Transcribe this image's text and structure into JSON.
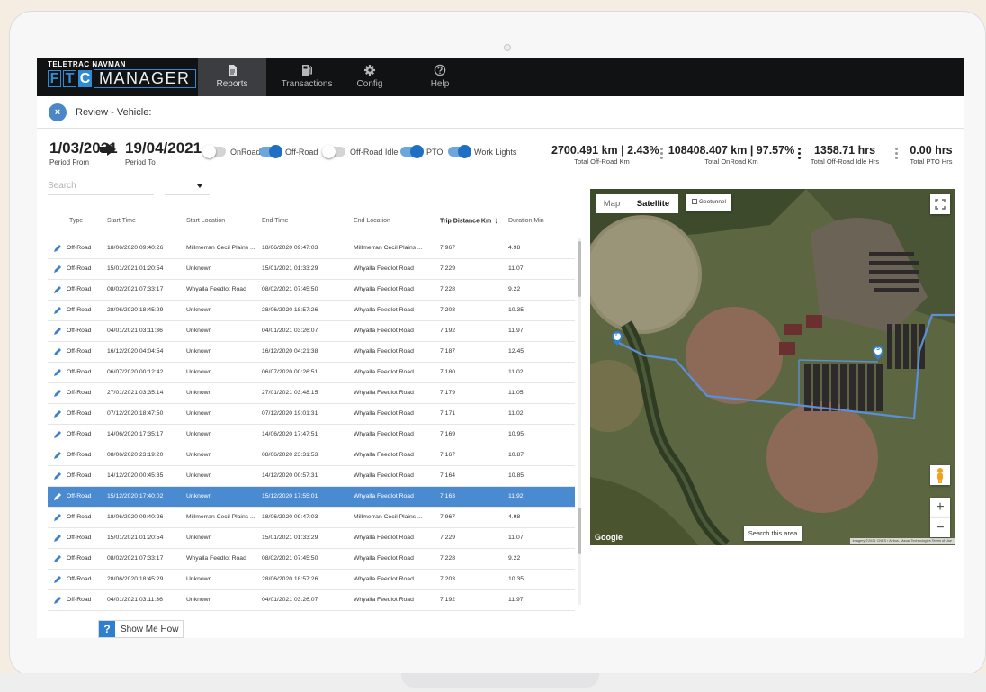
{
  "brand": {
    "company": "TELETRAC NAVMAN",
    "ftc_letters": [
      "F",
      "T",
      "C"
    ],
    "product": "MANAGER"
  },
  "nav": [
    {
      "label": "Reports",
      "icon": "document-icon",
      "active": true
    },
    {
      "label": "Transactions",
      "icon": "fuel-pump-icon",
      "active": false
    },
    {
      "label": "Config",
      "icon": "gear-icon",
      "active": false
    },
    {
      "label": "Help",
      "icon": "question-circle-icon",
      "active": false
    }
  ],
  "review": {
    "close_glyph": "×",
    "title": "Review - Vehicle:"
  },
  "period": {
    "from_value": "1/03/2021",
    "from_label": "Period From",
    "to_value": "19/04/2021",
    "to_label": "Period To"
  },
  "toggles": [
    {
      "label": "OnRoad",
      "on": false
    },
    {
      "label": "Off-Road",
      "on": true
    },
    {
      "label": "Off-Road Idle",
      "on": false
    },
    {
      "label": "PTO",
      "on": true
    },
    {
      "label": "Work Lights",
      "on": true
    }
  ],
  "stats": [
    {
      "value": "2700.491 km | 2.43%",
      "label": "Total Off-Road Km"
    },
    {
      "value": "108408.407 km | 97.57%",
      "label": "Total OnRoad Km"
    },
    {
      "value": "1358.71 hrs",
      "label": "Total Off-Road Idle Hrs"
    },
    {
      "value": "0.00 hrs",
      "label": "Total PTO Hrs"
    }
  ],
  "filters": {
    "search_placeholder": "Search",
    "select_value": ""
  },
  "table": {
    "columns": [
      "Type",
      "Start Time",
      "Start Location",
      "End Time",
      "End Location",
      "Trip Distance Km",
      "Duration Min"
    ],
    "sorted_column": "Trip Distance Km",
    "selected_row": 12,
    "rows": [
      [
        "Off-Road",
        "18/06/2020 09:40:26",
        "Millmerran Cecil Plains ...",
        "18/06/2020 09:47:03",
        "Millmerran Cecil Plains ...",
        "7.967",
        "4.98"
      ],
      [
        "Off-Road",
        "15/01/2021 01:20:54",
        "Unknown",
        "15/01/2021 01:33:29",
        "Whyalla Feedlot Road",
        "7.229",
        "11.07"
      ],
      [
        "Off-Road",
        "08/02/2021 07:33:17",
        "Whyalla Feedlot Road",
        "08/02/2021 07:45:50",
        "Whyalla Feedlot Road",
        "7.228",
        "9.22"
      ],
      [
        "Off-Road",
        "28/06/2020 18:45:29",
        "Unknown",
        "28/06/2020 18:57:26",
        "Whyalla Feedlot Road",
        "7.203",
        "10.35"
      ],
      [
        "Off-Road",
        "04/01/2021 03:11:36",
        "Unknown",
        "04/01/2021 03:26:07",
        "Whyalla Feedlot Road",
        "7.192",
        "11.97"
      ],
      [
        "Off-Road",
        "16/12/2020 04:04:54",
        "Unknown",
        "16/12/2020 04:21:38",
        "Whyalla Feedlot Road",
        "7.187",
        "12.45"
      ],
      [
        "Off-Road",
        "06/07/2020 00:12:42",
        "Unknown",
        "06/07/2020 00:26:51",
        "Whyalla Feedlot Road",
        "7.180",
        "11.02"
      ],
      [
        "Off-Road",
        "27/01/2021 03:35:14",
        "Unknown",
        "27/01/2021 03:48:15",
        "Whyalla Feedlot Road",
        "7.179",
        "11.05"
      ],
      [
        "Off-Road",
        "07/12/2020 18:47:50",
        "Unknown",
        "07/12/2020 19:01:31",
        "Whyalla Feedlot Road",
        "7.171",
        "11.02"
      ],
      [
        "Off-Road",
        "14/06/2020 17:35:17",
        "Unknown",
        "14/06/2020 17:47:51",
        "Whyalla Feedlot Road",
        "7.169",
        "10.95"
      ],
      [
        "Off-Road",
        "08/06/2020 23:19:20",
        "Unknown",
        "08/06/2020 23:31:53",
        "Whyalla Feedlot Road",
        "7.167",
        "10.87"
      ],
      [
        "Off-Road",
        "14/12/2020 00:45:35",
        "Unknown",
        "14/12/2020 00:57:31",
        "Whyalla Feedlot Road",
        "7.164",
        "10.85"
      ],
      [
        "Off-Road",
        "15/12/2020 17:40:02",
        "Unknown",
        "15/12/2020 17:55:01",
        "Whyalla Feedlot Road",
        "7.163",
        "11.92"
      ],
      [
        "Off-Road",
        "18/06/2020 09:40:26",
        "Millmerran Cecil Plains ...",
        "18/06/2020 09:47:03",
        "Millmerran Cecil Plains ...",
        "7.967",
        "4.98"
      ],
      [
        "Off-Road",
        "15/01/2021 01:20:54",
        "Unknown",
        "15/01/2021 01:33:29",
        "Whyalla Feedlot Road",
        "7.229",
        "11.07"
      ],
      [
        "Off-Road",
        "08/02/2021 07:33:17",
        "Whyalla Feedlot Road",
        "08/02/2021 07:45:50",
        "Whyalla Feedlot Road",
        "7.228",
        "9.22"
      ],
      [
        "Off-Road",
        "28/06/2020 18:45:29",
        "Unknown",
        "28/06/2020 18:57:26",
        "Whyalla Feedlot Road",
        "7.203",
        "10.35"
      ],
      [
        "Off-Road",
        "04/01/2021 03:11:36",
        "Unknown",
        "04/01/2021 03:26:07",
        "Whyalla Feedlot Road",
        "7.192",
        "11.97"
      ]
    ]
  },
  "map": {
    "tab_map": "Map",
    "tab_satellite": "Satellite",
    "active_tab": "Satellite",
    "geotunnel_label": "Geotunnel",
    "search_area_label": "Search this area",
    "google_label": "Google",
    "attribution": "Imagery ©2021 CNES / Airbus, Maxar Technologies   Terms of Use",
    "start_marker": "F",
    "end_marker": "S",
    "route_color": "#5b8fd6"
  },
  "help": {
    "glyph": "?",
    "label": "Show Me How"
  },
  "colors": {
    "accent": "#2f7fcf",
    "selected_row": "#4a8ad0",
    "nav_bg": "#111213"
  }
}
